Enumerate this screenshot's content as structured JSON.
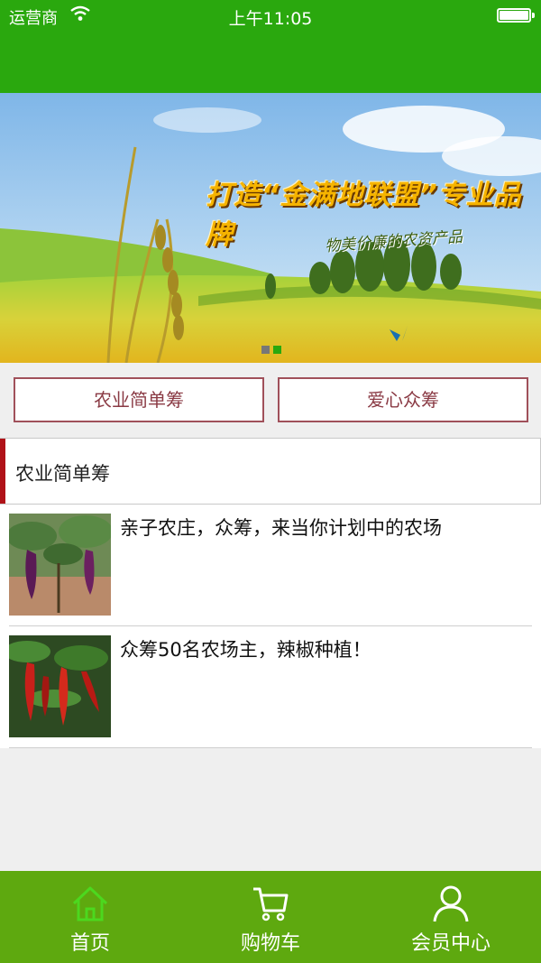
{
  "status_bar": {
    "carrier": "运营商",
    "time": "上午11:05"
  },
  "banner": {
    "slogan": "打造“金满地联盟”专业品牌",
    "subtitle": "物美价廉的农资产品",
    "dots": 2,
    "active_dot": 1
  },
  "buttons": {
    "left": "农业简单筹",
    "right": "爱心众筹"
  },
  "section": {
    "title": "农业简单筹",
    "accent_color": "#b01218"
  },
  "items": [
    {
      "title": "亲子农庄，众筹，来当你计划中的农场",
      "image": "eggplant-photo"
    },
    {
      "title": "众筹50名农场主，辣椒种植！",
      "image": "chili-photo"
    }
  ],
  "tabbar": {
    "tabs": [
      {
        "label": "首页",
        "icon": "home-icon",
        "active": true
      },
      {
        "label": "购物车",
        "icon": "cart-icon",
        "active": false
      },
      {
        "label": "会员中心",
        "icon": "user-icon",
        "active": false
      }
    ]
  },
  "colors": {
    "header": "#2aa80e",
    "tabbar": "#5ea90f",
    "button_border": "#a0505a"
  }
}
